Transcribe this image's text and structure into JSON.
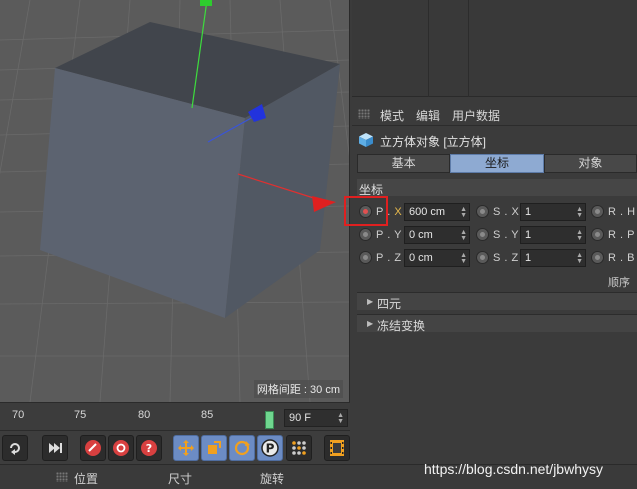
{
  "viewport": {
    "grid_spacing": "网格间距 : 30 cm"
  },
  "timeline": {
    "ticks": [
      "70",
      "75",
      "80",
      "85"
    ],
    "frame_field": "90 F"
  },
  "bottom_strip": {
    "position": "位置",
    "size": "尺寸",
    "rotation": "旋转"
  },
  "attributes": {
    "menu": [
      "模式",
      "编辑",
      "用户数据"
    ],
    "object_title": "立方体对象 [立方体]",
    "tabs": [
      "基本",
      "坐标",
      "对象"
    ],
    "active_tab": "坐标",
    "section": "坐标",
    "rows": [
      {
        "p_label_prefix": "P . ",
        "p_label_axis": "X",
        "p_value": "600 cm",
        "s_label": "S . X",
        "s_value": "1",
        "r_label": "R . H"
      },
      {
        "p_label_prefix": "P . ",
        "p_label_axis": "Y",
        "p_value": "0 cm",
        "s_label": "S . Y",
        "s_value": "1",
        "r_label": "R . P"
      },
      {
        "p_label_prefix": "P . ",
        "p_label_axis": "Z",
        "p_value": "0 cm",
        "s_label": "S . Z",
        "s_value": "1",
        "r_label": "R . B"
      }
    ],
    "order_label": "顺序",
    "collapsibles": [
      "四元",
      "冻结变换"
    ]
  },
  "watermark": "https://blog.csdn.net/jbwhysy",
  "colors": {
    "active_tab": "#8eaad2",
    "highlight": "#e02020",
    "accent_axis": "#e6b84c",
    "toolbar_blue": "#6c8cc4"
  },
  "icons": {
    "cube": "cube-icon",
    "move": "move-icon",
    "scale": "scale-icon",
    "rotate": "rotate-icon",
    "param": "parameter-icon",
    "record": "record-key-icon",
    "autokey": "autokey-icon",
    "help": "keyframe-help-icon",
    "last_frame": "go-to-end-icon",
    "loop": "loop-icon",
    "dots": "point-level-icon",
    "film": "film-icon"
  }
}
